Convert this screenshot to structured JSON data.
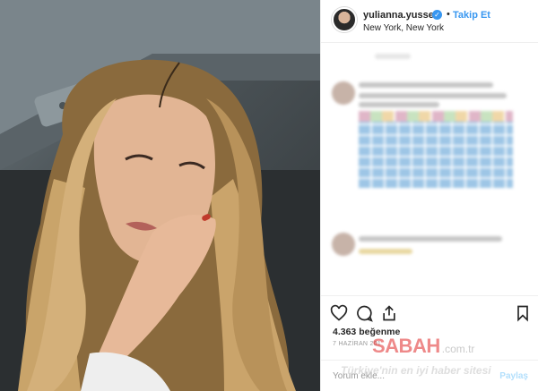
{
  "header": {
    "username": "yulianna.yussef",
    "follow_label": "Takip Et",
    "separator": "•",
    "location": "New York, New York"
  },
  "post": {
    "likes": "4.363 beğenme",
    "date": "7 HAZİRAN 201",
    "comment_placeholder": "Yorum ekle...",
    "share_label": "Paylaş"
  },
  "watermark": {
    "logo": "SABAH",
    "tld": ".com.tr",
    "slogan": "Türkiye'nin en iyi haber sitesi"
  },
  "icons": [
    "heart-icon",
    "comment-icon",
    "share-icon",
    "bookmark-icon",
    "verified-icon"
  ],
  "colors": {
    "accent": "#3897f0",
    "text": "#262626",
    "muted": "#999999"
  }
}
